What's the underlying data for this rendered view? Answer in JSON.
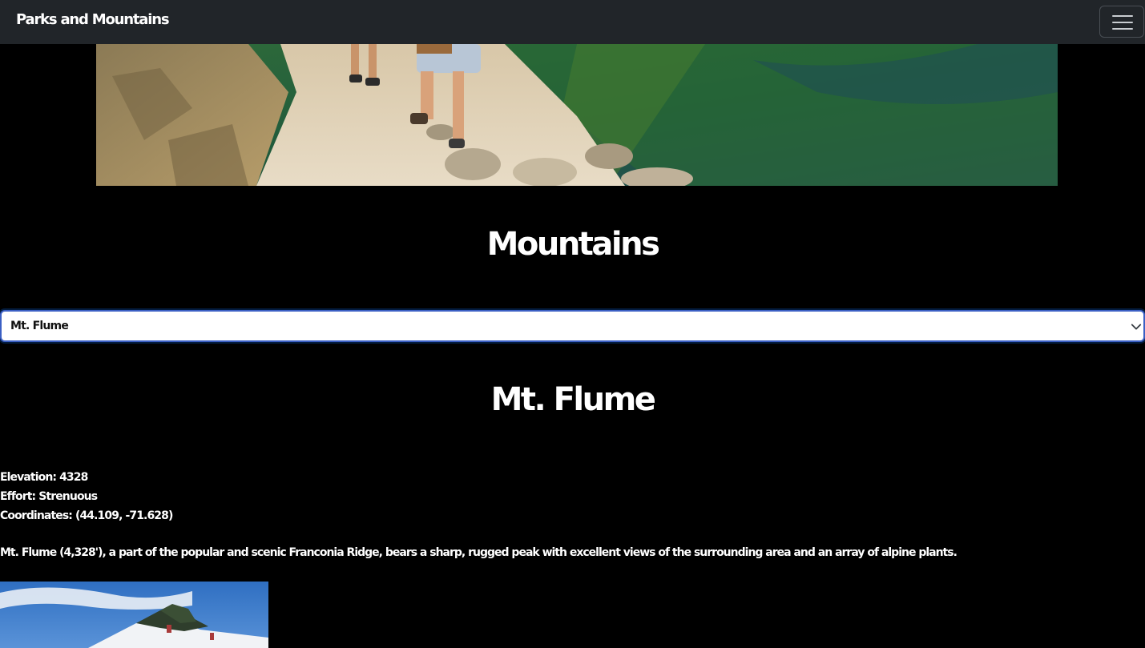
{
  "navbar": {
    "brand": "Parks and Mountains",
    "toggle_icon": "menu-icon"
  },
  "hero": {
    "alt": "hikers on a rocky trail above a forested valley"
  },
  "page": {
    "section_title": "Mountains"
  },
  "mountain_select": {
    "selected": "Mt. Flume",
    "chevron_icon": "chevron-down-icon"
  },
  "mountain": {
    "name": "Mt. Flume",
    "elevation": "Elevation: 4328",
    "effort": "Effort: Strenuous",
    "coordinates": "Coordinates: (44.109, -71.628)",
    "description": "Mt. Flume (4,328'), a part of the popular and scenic Franconia Ridge, bears a sharp, rugged peak with excellent views of the surrounding area and an array of alpine plants."
  },
  "colors": {
    "navbar_bg": "#212529",
    "page_bg": "#000000",
    "select_border": "#3b5fc4",
    "text": "#ffffff"
  }
}
